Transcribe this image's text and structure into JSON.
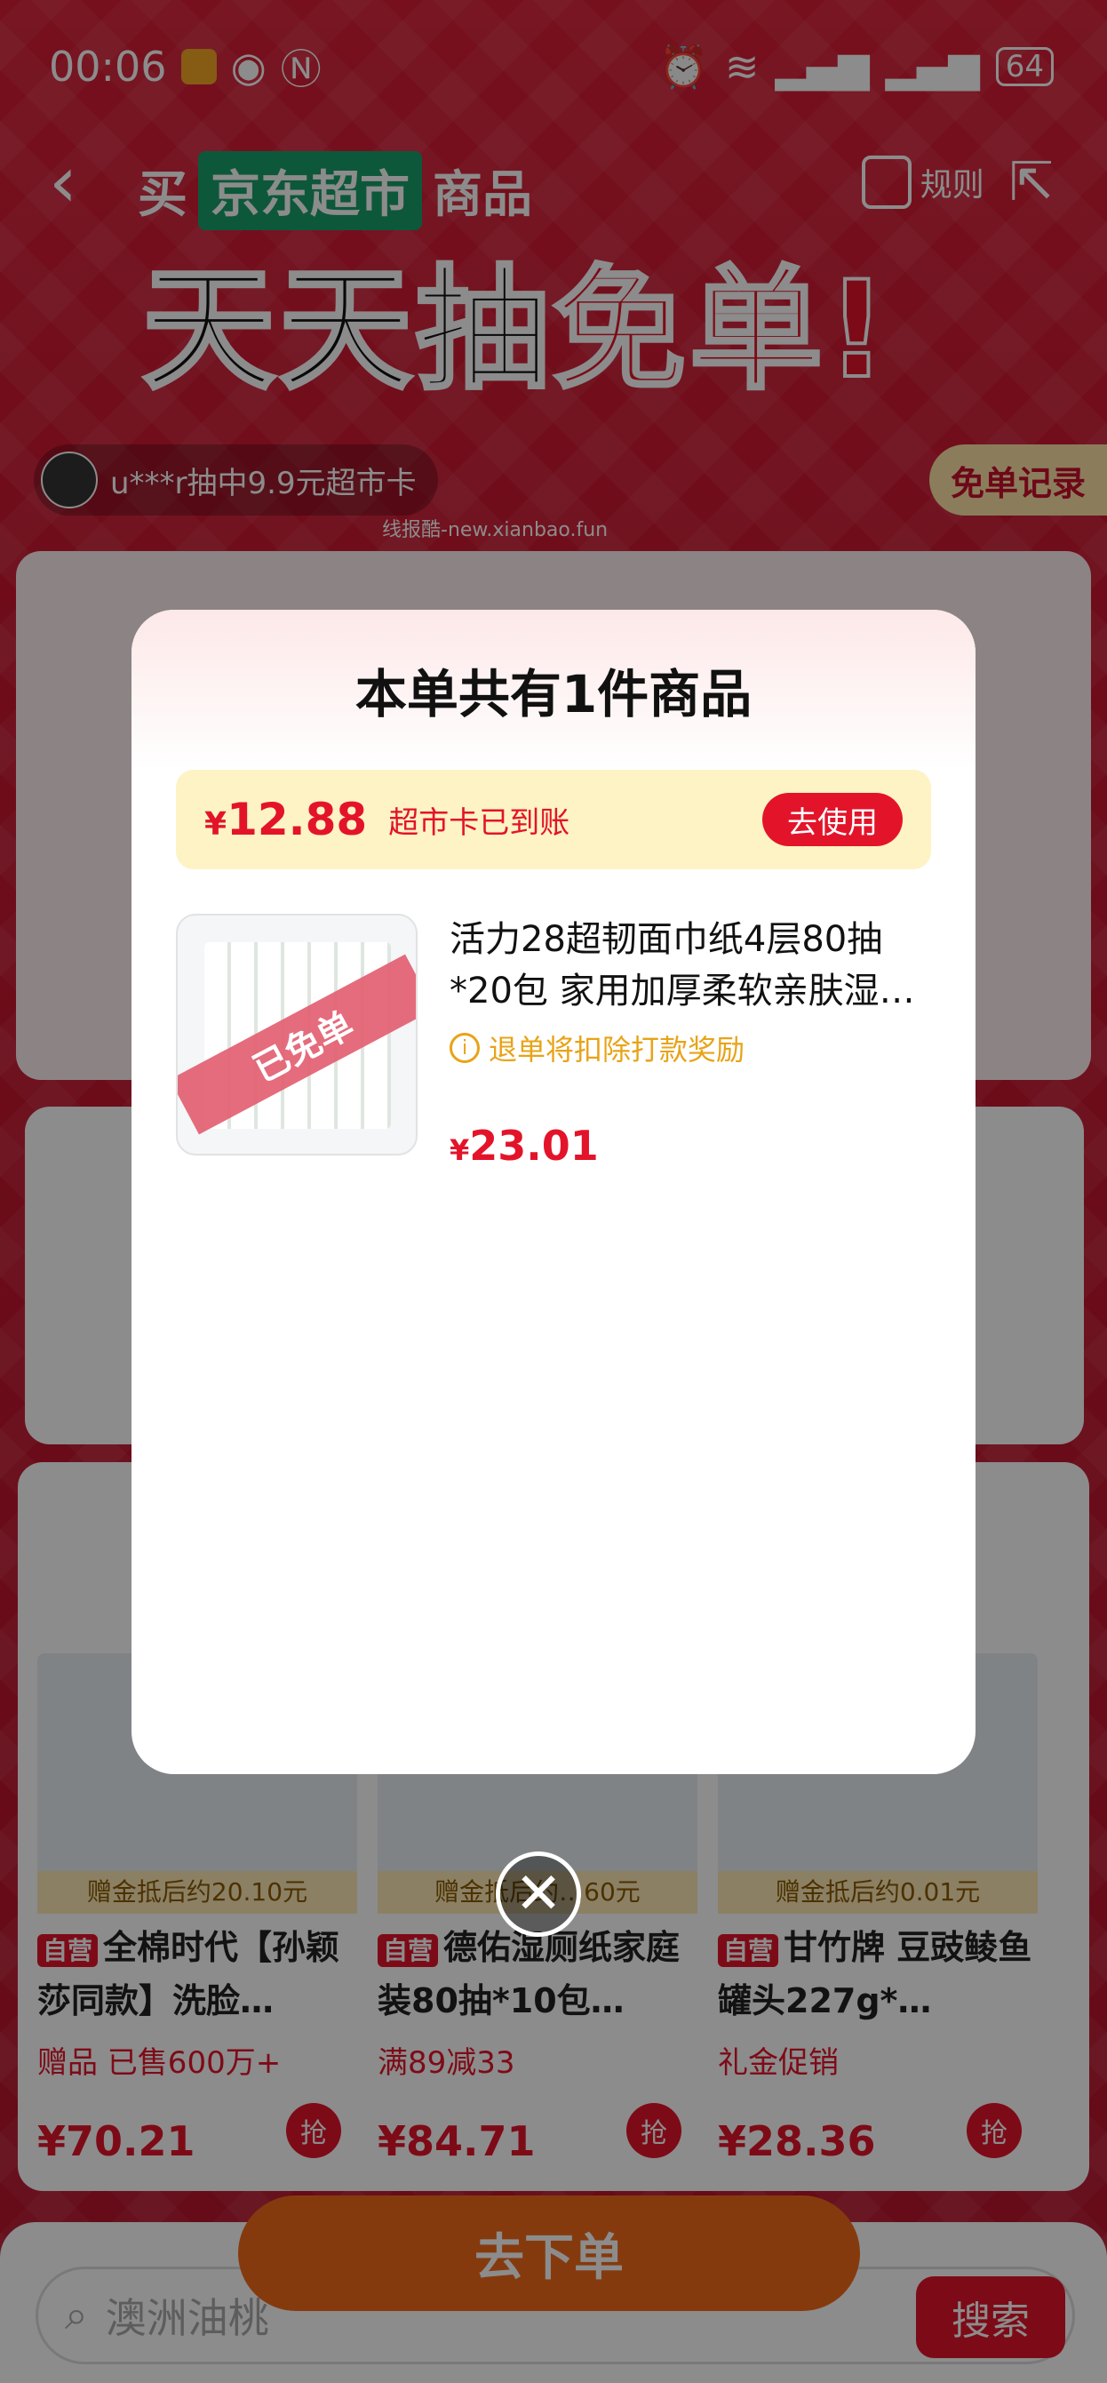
{
  "status_bar": {
    "time": "00:06",
    "battery": "64"
  },
  "header": {
    "prefix": "买",
    "store": "京东超市",
    "suffix": "商品",
    "rules_label": "规则",
    "banner_black": "天天抽",
    "banner_red": "免单!"
  },
  "winner_ticker": "u***r抽中9.9元超市卡",
  "record_button": "免单记录",
  "watermark": "线报酷-new.xianbao.fun",
  "background_goods": [
    {
      "gift": "赠金抵后约20.10元",
      "badge": "自营",
      "name": "全棉时代【孙颖莎同款】洗脸…",
      "sub": "赠品 已售600万+",
      "price": "¥70.21",
      "buy": "抢"
    },
    {
      "gift": "赠金抵后约…60元",
      "badge": "自营",
      "name": "德佑湿厕纸家庭装80抽*10包…",
      "sub": "满89减33",
      "price": "¥84.71",
      "buy": "抢"
    },
    {
      "gift": "赠金抵后约0.01元",
      "badge": "自营",
      "name": "甘竹牌 豆豉鲮鱼罐头227g*…",
      "sub": "礼金促销",
      "price": "¥28.36",
      "buy": "抢"
    }
  ],
  "order_button": "去下单",
  "search": {
    "placeholder": "澳洲油桃",
    "button": "搜索"
  },
  "modal": {
    "title": "本单共有1件商品",
    "card_amount_symbol": "¥",
    "card_amount": "12.88",
    "card_text": "超市卡已到账",
    "use_button": "去使用",
    "item": {
      "name": "活力28超韧面巾纸4层80抽*20包 家用加厚柔软亲肤湿…",
      "ribbon": "已免单",
      "warning": "退单将扣除打款奖励",
      "price_symbol": "¥",
      "price": "23.01"
    }
  }
}
